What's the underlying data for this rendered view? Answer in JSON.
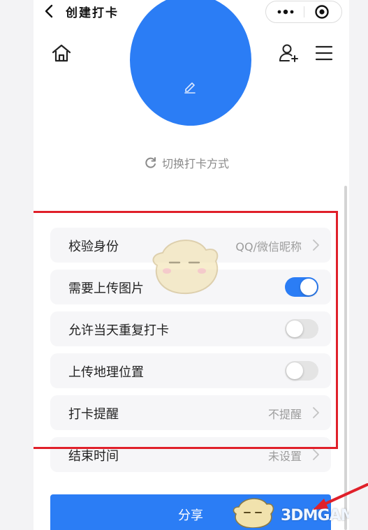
{
  "topbar": {
    "title": "创建打卡"
  },
  "header": {
    "switch_label": "切换打卡方式"
  },
  "settings": [
    {
      "label": "校验身份",
      "value": "QQ/微信昵称",
      "control": "chevron"
    },
    {
      "label": "需要上传图片",
      "control": "toggle",
      "on": true
    },
    {
      "label": "允许当天重复打卡",
      "control": "toggle",
      "on": false
    },
    {
      "label": "上传地理位置",
      "control": "toggle",
      "on": false
    },
    {
      "label": "打卡提醒",
      "value": "不提醒",
      "control": "chevron"
    },
    {
      "label": "结束时间",
      "value": "未设置",
      "control": "chevron"
    }
  ],
  "footer": {
    "share_label": "分享"
  },
  "watermark": {
    "text": "3DMGAME"
  },
  "colors": {
    "accent": "#2b7df5",
    "annotation": "#e0202a",
    "row_bg": "#f6f6f8"
  },
  "icons": [
    "back-arrow-icon",
    "more-dots-icon",
    "close-target-icon",
    "home-icon",
    "add-user-icon",
    "menu-icon",
    "pen-icon",
    "refresh-icon",
    "chevron-right-icon"
  ]
}
